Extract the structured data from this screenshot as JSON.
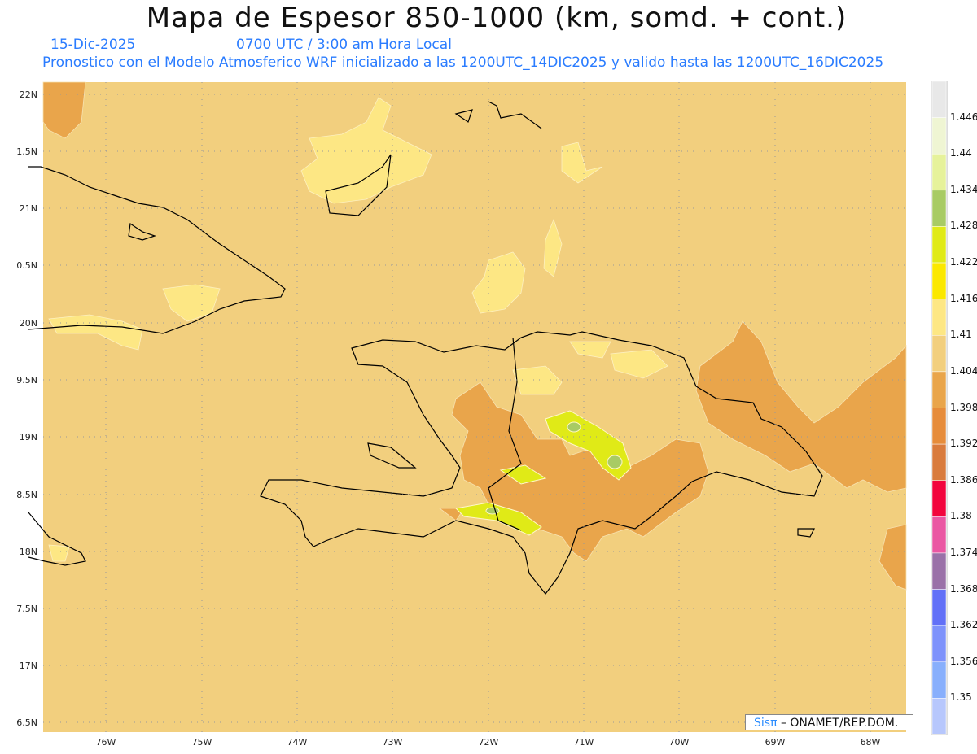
{
  "title": "Mapa de Espesor 850-1000 (km, somd. + cont.)",
  "date": "15-Dic-2025",
  "time": "0700 UTC / 3:00 am Hora Local",
  "description": "Pronostico con el Modelo Atmosferico WRF inicializado a las 1200UTC_14DIC2025 y valido hasta las  1200UTC_16DIC2025",
  "lat_labels": [
    "22N",
    "1.5N",
    "21N",
    "0.5N",
    "20N",
    "9.5N",
    "19N",
    "8.5N",
    "18N",
    "7.5N",
    "17N",
    "6.5N"
  ],
  "lon_labels": [
    "76W",
    "75W",
    "74W",
    "73W",
    "72W",
    "71W",
    "70W",
    "69W",
    "68W"
  ],
  "colorbar": {
    "labels": [
      "1.446",
      "1.44",
      "1.434",
      "1.428",
      "1.422",
      "1.416",
      "1.41",
      "1.404",
      "1.398",
      "1.392",
      "1.386",
      "1.38",
      "1.374",
      "1.368",
      "1.362",
      "1.356",
      "1.35"
    ],
    "colors": [
      "#e8e8e8",
      "#eff5d3",
      "#e6f29b",
      "#a8cb64",
      "#e0ea17",
      "#fbe800",
      "#fde784",
      "#f2cf7e",
      "#e9a54b",
      "#e68c3b",
      "#d97b3d",
      "#f2053d",
      "#ea57a3",
      "#9a71a8",
      "#6270f7",
      "#7e92fb",
      "#88affc",
      "#b7c7fc"
    ]
  },
  "credit": {
    "brand": "Sisπ",
    "text": " – ONAMET/REP.DOM."
  },
  "colors": {
    "base": "#f2cf7e",
    "orange": "#e9a54b",
    "yellow": "#fde784",
    "lime": "#e0ea17",
    "green": "#a8cb64"
  }
}
